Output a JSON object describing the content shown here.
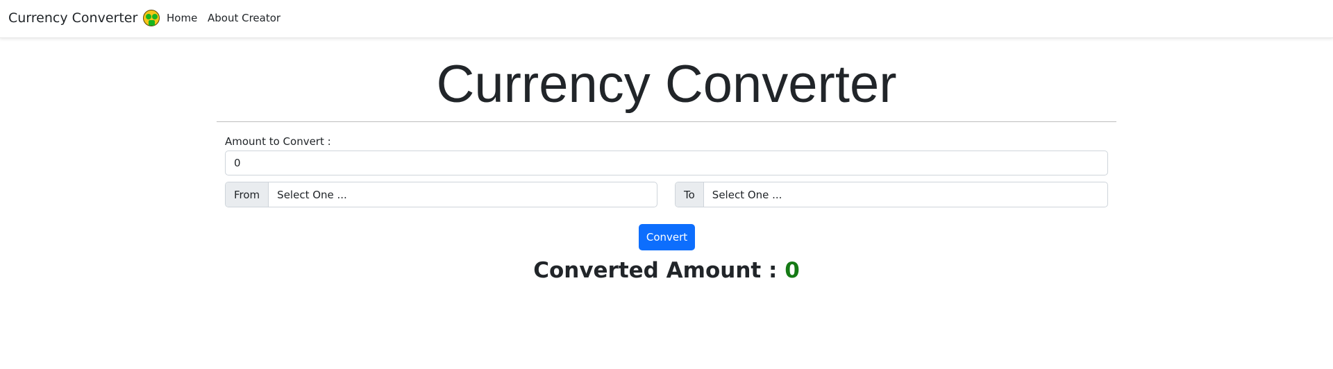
{
  "navbar": {
    "brand": "Currency Converter",
    "links": [
      "Home",
      "About Creator"
    ]
  },
  "main": {
    "title": "Currency Converter",
    "amount_label": "Amount to Convert :",
    "amount_value": "0",
    "from_label": "From",
    "from_value": "Select One ...",
    "to_label": "To",
    "to_value": "Select One ...",
    "convert_button": "Convert",
    "result_label": "Converted Amount :",
    "result_value": "0"
  }
}
